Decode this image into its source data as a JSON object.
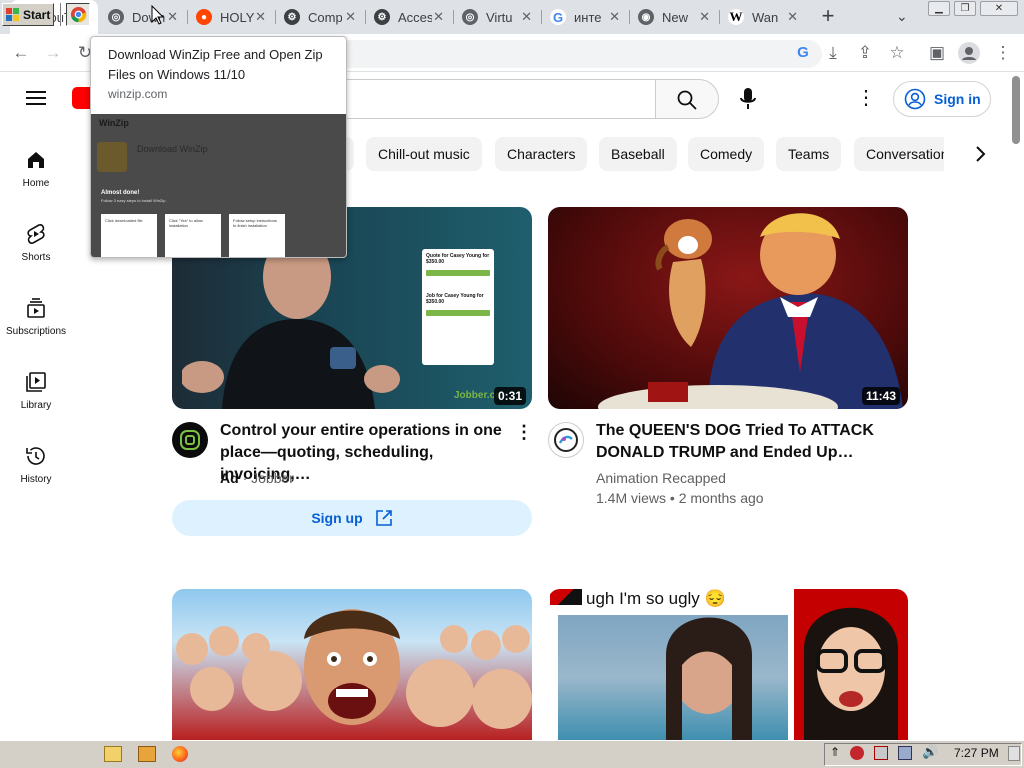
{
  "browser": {
    "tabs": [
      {
        "label": "YouTube",
        "icon": "youtube-icon",
        "color": "#ff0000",
        "active": true
      },
      {
        "label": "Download WinZip",
        "icon": "globe-icon",
        "color": "#5f6368",
        "active": false
      },
      {
        "label": "HOLY",
        "icon": "reddit-icon",
        "color": "#ff4500",
        "active": false
      },
      {
        "label": "Comp",
        "icon": "gear-icon",
        "color": "#3c4043",
        "active": false
      },
      {
        "label": "Access",
        "icon": "gear-icon",
        "color": "#3c4043",
        "active": false
      },
      {
        "label": "Virtu",
        "icon": "globe-icon",
        "color": "#5f6368",
        "active": false
      },
      {
        "label": "инте",
        "icon": "google-icon",
        "color": "#4285f4",
        "active": false
      },
      {
        "label": "New",
        "icon": "chrome-icon",
        "color": "#5f6368",
        "active": false
      },
      {
        "label": "Wan",
        "icon": "wikipedia-icon",
        "color": "#000000",
        "active": false
      }
    ],
    "new_tab_label": "+",
    "tooltip": {
      "title": "Download WinZip Free and Open Zip Files on Windows 11/10",
      "domain": "winzip.com",
      "preview": {
        "brand": "WinZip",
        "heading": "Download WinZip",
        "almost_done": "Almost done!",
        "steps_caption": "Follow 3 easy steps to install WinZip.",
        "step1": "Click downloaded file",
        "step2": "Click \"Yes\" to allow installation",
        "step3": "Follow setup instructions to finish installation"
      }
    }
  },
  "youtube": {
    "sign_in": "Sign in",
    "search_placeholder": "",
    "sidebar": [
      {
        "label": "Home",
        "icon": "home-icon"
      },
      {
        "label": "Shorts",
        "icon": "shorts-icon"
      },
      {
        "label": "Subscriptions",
        "icon": "subscriptions-icon"
      },
      {
        "label": "Library",
        "icon": "library-icon"
      },
      {
        "label": "History",
        "icon": "history-icon"
      }
    ],
    "chips": [
      "Chill-out music",
      "Characters",
      "Baseball",
      "Comedy",
      "Teams",
      "Conversation"
    ],
    "videos": [
      {
        "title": "Control your entire operations in one place—quoting, scheduling, invoicing,…",
        "ad_label": "Ad",
        "channel": "Jobber",
        "duration": "0:31",
        "cta": "Sign up",
        "thumb_card": {
          "quote": "Quote for Casey Young for $350.00",
          "job": "Job for Casey Young for $350.00",
          "brand": "Jobber.co"
        }
      },
      {
        "title": "The QUEEN'S DOG Tried To ATTACK DONALD TRUMP and Ended Up…",
        "channel": "Animation Recapped",
        "views": "1.4M views",
        "age": "2 months ago",
        "duration": "11:43"
      },
      {
        "title": "",
        "overlay": ""
      },
      {
        "title": "",
        "overlay": "ugh I'm so ugly 😔"
      }
    ]
  },
  "taskbar": {
    "start": "Start",
    "clock": "7:27 PM"
  }
}
